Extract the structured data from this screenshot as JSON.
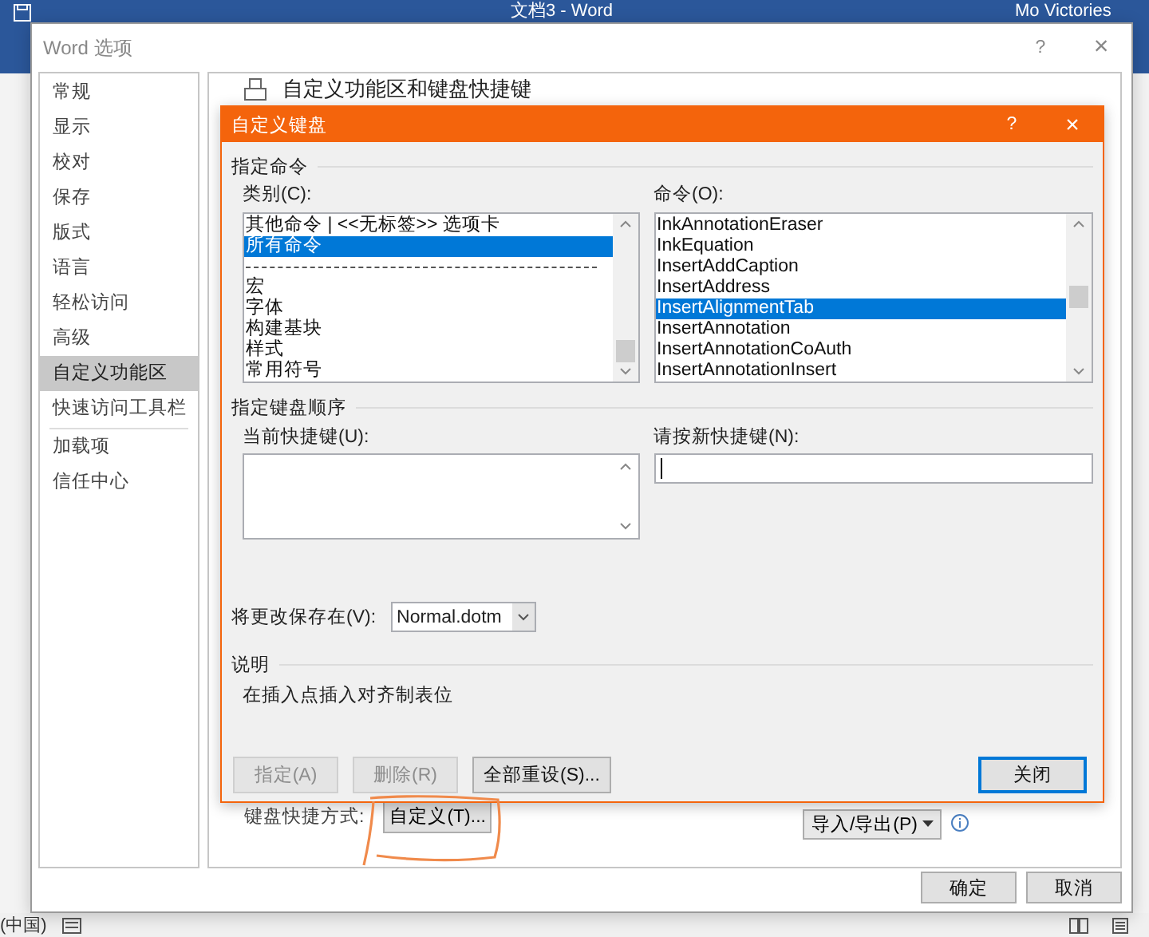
{
  "app_window": {
    "title": "文档3 - Word",
    "user": "Mo Victories"
  },
  "options_dialog": {
    "title": "Word 选项",
    "help": "?",
    "close": "×",
    "nav": [
      {
        "label": "常规",
        "selected": false
      },
      {
        "label": "显示",
        "selected": false
      },
      {
        "label": "校对",
        "selected": false
      },
      {
        "label": "保存",
        "selected": false
      },
      {
        "label": "版式",
        "selected": false
      },
      {
        "label": "语言",
        "selected": false
      },
      {
        "label": "轻松访问",
        "selected": false
      },
      {
        "label": "高级",
        "selected": false
      },
      {
        "label": "自定义功能区",
        "selected": true
      },
      {
        "label": "快速访问工具栏",
        "selected": false
      },
      {
        "label": "加载项",
        "selected": false
      },
      {
        "label": "信任中心",
        "selected": false
      }
    ],
    "section_title": "自定义功能区和键盘快捷键",
    "shortcuts_label": "键盘快捷方式:",
    "customize_button": "自定义(T)...",
    "import_export_button": "导入/导出(P)",
    "buttons": [
      "确定",
      "取消"
    ]
  },
  "keyboard_dialog": {
    "title": "自定义键盘",
    "help": "?",
    "close": "×",
    "command_heading": "指定命令",
    "categories": {
      "label": "类别(C):",
      "items": [
        {
          "kind": "item",
          "label": "其他命令 | <<无标签>> 选项卡",
          "selected": false
        },
        {
          "kind": "item",
          "label": "所有命令",
          "selected": true
        },
        {
          "kind": "separator"
        },
        {
          "kind": "item",
          "label": "宏",
          "selected": false
        },
        {
          "kind": "item",
          "label": "字体",
          "selected": false
        },
        {
          "kind": "item",
          "label": "构建基块",
          "selected": false
        },
        {
          "kind": "item",
          "label": "样式",
          "selected": false
        },
        {
          "kind": "item",
          "label": "常用符号",
          "selected": false
        }
      ]
    },
    "commands": {
      "label": "命令(O):",
      "items": [
        {
          "kind": "item",
          "label": "InkAnnotationEraser",
          "selected": false
        },
        {
          "kind": "item",
          "label": "InkEquation",
          "selected": false
        },
        {
          "kind": "item",
          "label": "InsertAddCaption",
          "selected": false
        },
        {
          "kind": "item",
          "label": "InsertAddress",
          "selected": false
        },
        {
          "kind": "item",
          "label": "InsertAlignmentTab",
          "selected": true
        },
        {
          "kind": "item",
          "label": "InsertAnnotation",
          "selected": false
        },
        {
          "kind": "item",
          "label": "InsertAnnotationCoAuth",
          "selected": false
        },
        {
          "kind": "item",
          "label": "InsertAnnotationInsert",
          "selected": false
        }
      ]
    },
    "sequence_heading": "指定键盘顺序",
    "current_keys_label": "当前快捷键(U):",
    "new_key_label": "请按新快捷键(N):",
    "save_in": {
      "label": "将更改保存在(V):",
      "value": "Normal.dotm"
    },
    "description_heading": "说明",
    "description": "在插入点插入对齐制表位",
    "buttons": [
      {
        "label": "指定(A)",
        "disabled": true
      },
      {
        "label": "删除(R)",
        "disabled": true
      },
      {
        "label": "全部重设(S)...",
        "disabled": false
      },
      {
        "label": "关闭",
        "disabled": false,
        "default": true
      }
    ]
  },
  "status_bar": {
    "language": "(中国)"
  }
}
